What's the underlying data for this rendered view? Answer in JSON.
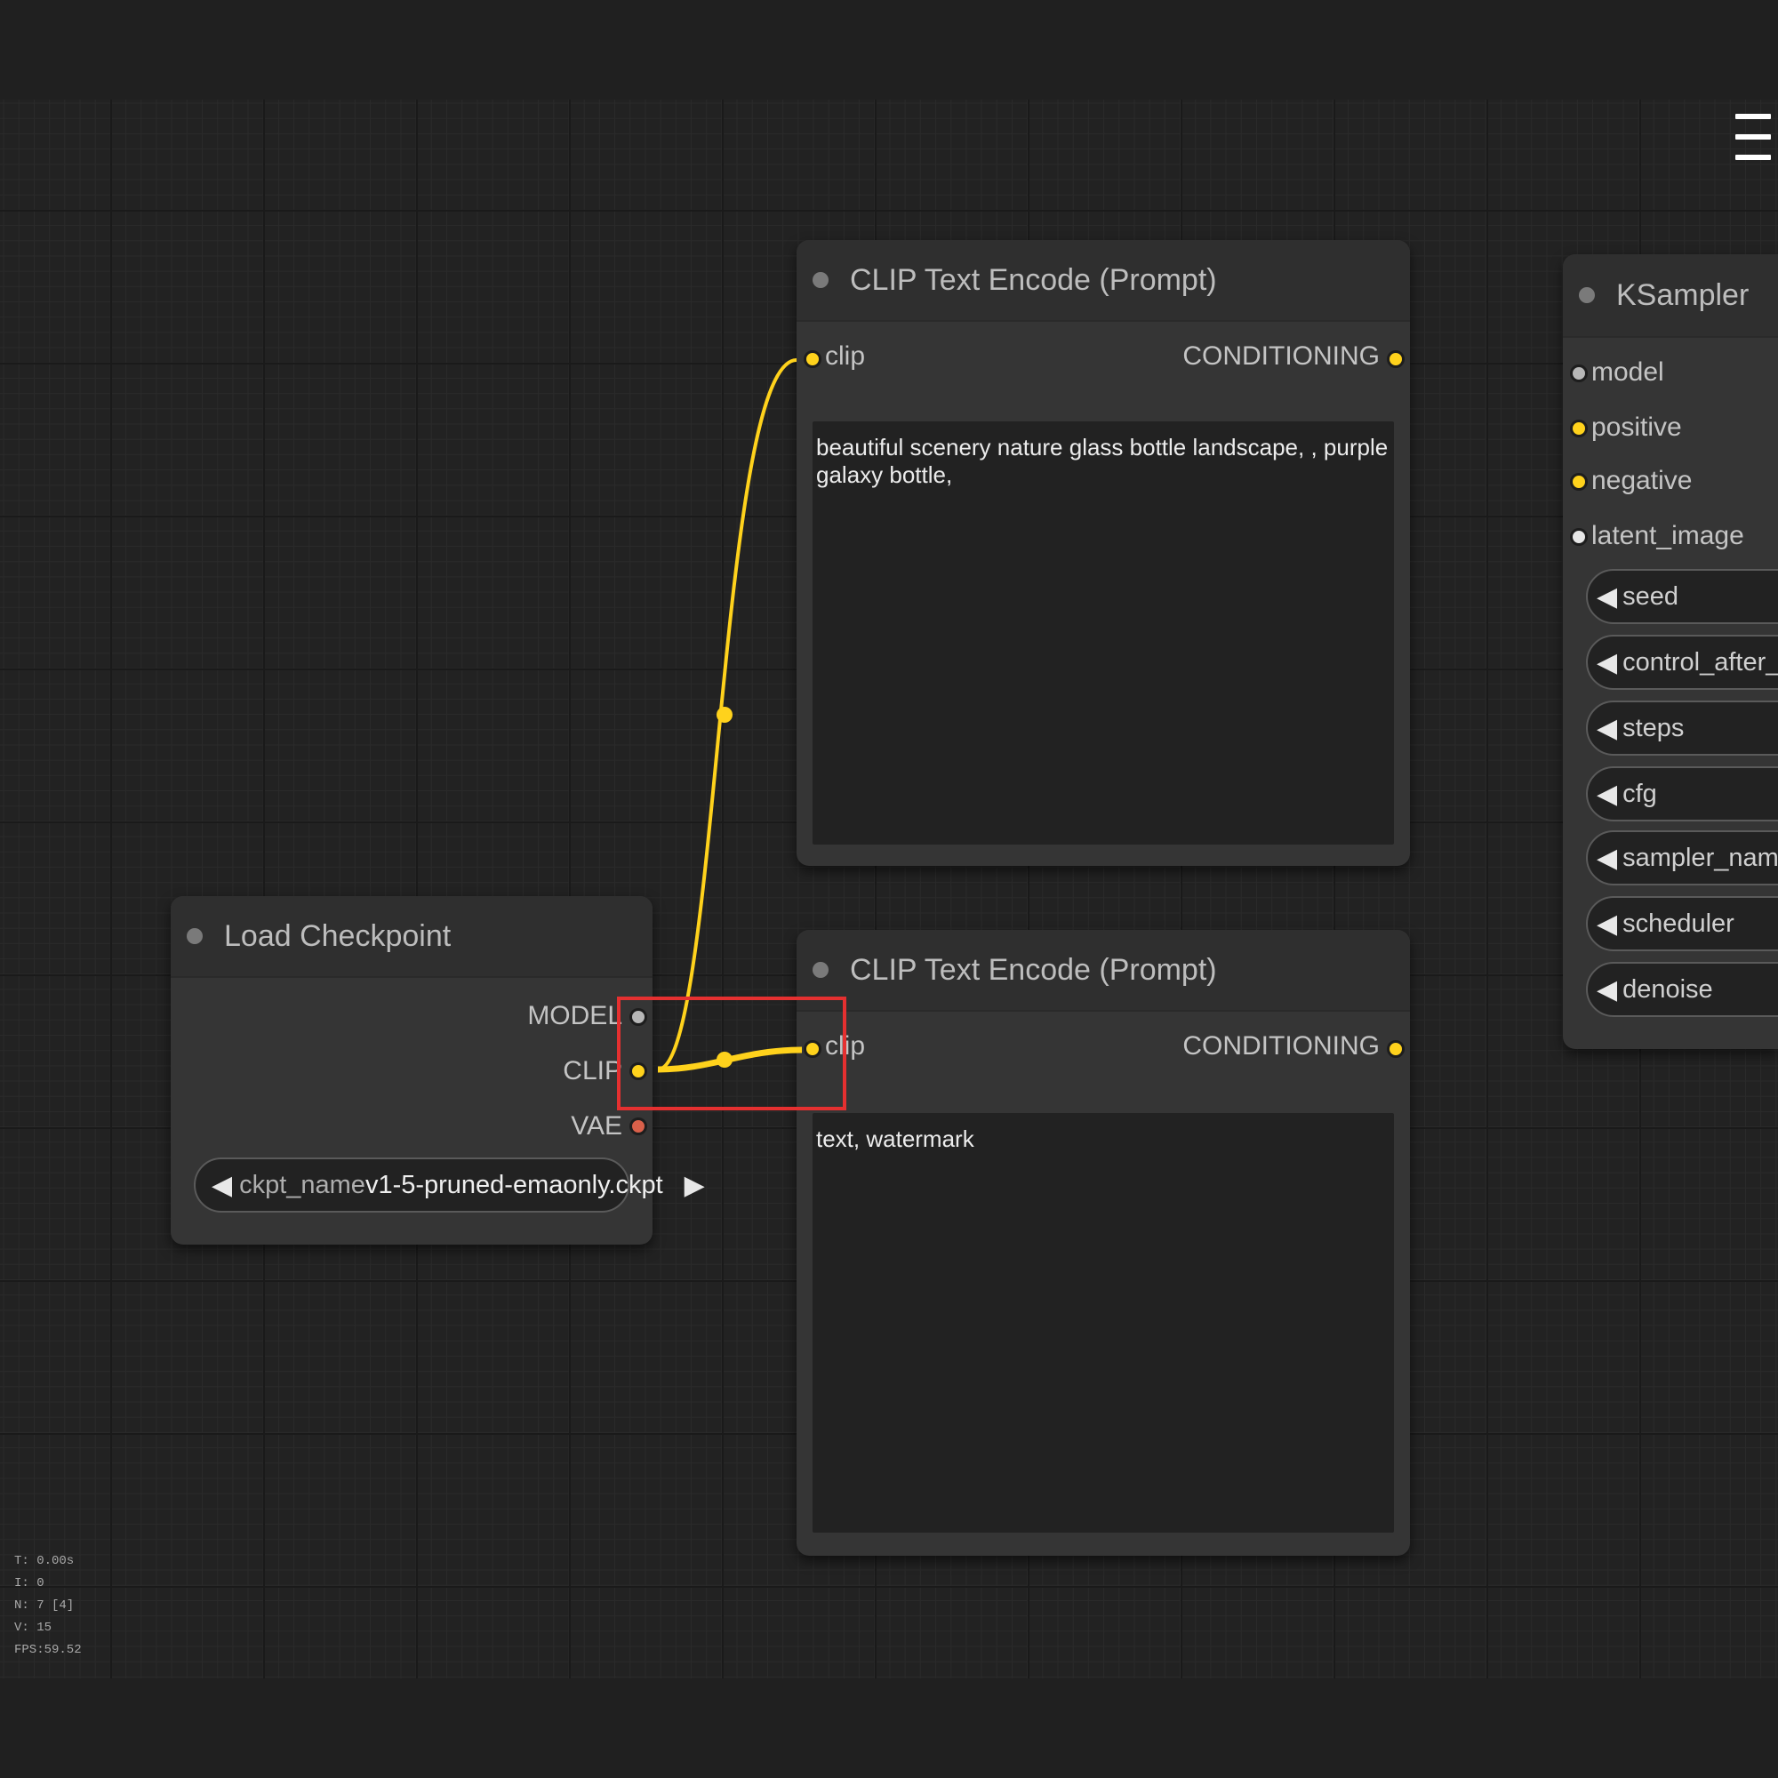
{
  "menu": {
    "icon": "hamburger-icon"
  },
  "nodes": {
    "clip_positive": {
      "title": "CLIP Text Encode (Prompt)",
      "input": "clip",
      "output": "CONDITIONING",
      "text": "beautiful scenery nature glass bottle landscape, , purple galaxy bottle,"
    },
    "clip_negative": {
      "title": "CLIP Text Encode (Prompt)",
      "input": "clip",
      "output": "CONDITIONING",
      "text": "text, watermark"
    },
    "load_checkpoint": {
      "title": "Load Checkpoint",
      "outputs": [
        "MODEL",
        "CLIP",
        "VAE"
      ],
      "ckpt_label": "ckpt_name",
      "ckpt_value": "v1-5-pruned-emaonly.ckpt"
    },
    "ksampler": {
      "title": "KSampler",
      "inputs": [
        "model",
        "positive",
        "negative",
        "latent_image"
      ],
      "widgets": [
        "seed",
        "control_after_genera",
        "steps",
        "cfg",
        "sampler_name",
        "scheduler",
        "denoise"
      ]
    }
  },
  "stats": {
    "t": "T: 0.00s",
    "i": "I: 0",
    "n": "N: 7 [4]",
    "v": "V: 15",
    "fps": "FPS:59.52"
  },
  "colors": {
    "clip_link": "#ffd21c",
    "highlight": "#e53030",
    "canvas": "#222222",
    "node": "#353535"
  }
}
